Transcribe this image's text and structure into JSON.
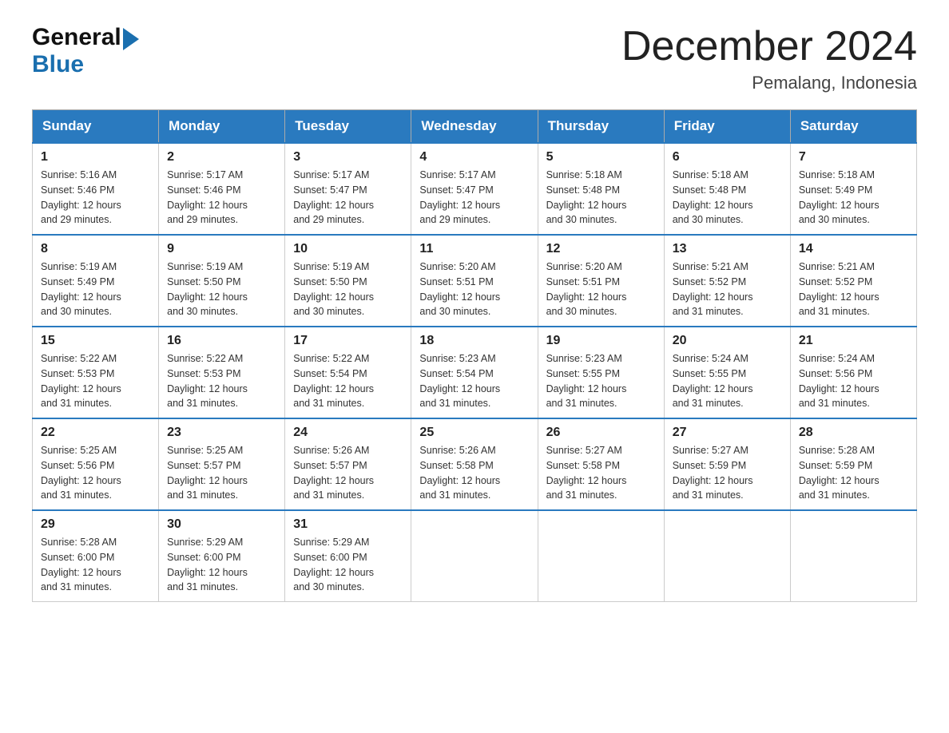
{
  "header": {
    "logo_general": "General",
    "logo_blue": "Blue",
    "month_title": "December 2024",
    "location": "Pemalang, Indonesia"
  },
  "weekdays": [
    "Sunday",
    "Monday",
    "Tuesday",
    "Wednesday",
    "Thursday",
    "Friday",
    "Saturday"
  ],
  "weeks": [
    [
      {
        "day": "1",
        "sunrise": "5:16 AM",
        "sunset": "5:46 PM",
        "daylight": "12 hours and 29 minutes."
      },
      {
        "day": "2",
        "sunrise": "5:17 AM",
        "sunset": "5:46 PM",
        "daylight": "12 hours and 29 minutes."
      },
      {
        "day": "3",
        "sunrise": "5:17 AM",
        "sunset": "5:47 PM",
        "daylight": "12 hours and 29 minutes."
      },
      {
        "day": "4",
        "sunrise": "5:17 AM",
        "sunset": "5:47 PM",
        "daylight": "12 hours and 29 minutes."
      },
      {
        "day": "5",
        "sunrise": "5:18 AM",
        "sunset": "5:48 PM",
        "daylight": "12 hours and 30 minutes."
      },
      {
        "day": "6",
        "sunrise": "5:18 AM",
        "sunset": "5:48 PM",
        "daylight": "12 hours and 30 minutes."
      },
      {
        "day": "7",
        "sunrise": "5:18 AM",
        "sunset": "5:49 PM",
        "daylight": "12 hours and 30 minutes."
      }
    ],
    [
      {
        "day": "8",
        "sunrise": "5:19 AM",
        "sunset": "5:49 PM",
        "daylight": "12 hours and 30 minutes."
      },
      {
        "day": "9",
        "sunrise": "5:19 AM",
        "sunset": "5:50 PM",
        "daylight": "12 hours and 30 minutes."
      },
      {
        "day": "10",
        "sunrise": "5:19 AM",
        "sunset": "5:50 PM",
        "daylight": "12 hours and 30 minutes."
      },
      {
        "day": "11",
        "sunrise": "5:20 AM",
        "sunset": "5:51 PM",
        "daylight": "12 hours and 30 minutes."
      },
      {
        "day": "12",
        "sunrise": "5:20 AM",
        "sunset": "5:51 PM",
        "daylight": "12 hours and 30 minutes."
      },
      {
        "day": "13",
        "sunrise": "5:21 AM",
        "sunset": "5:52 PM",
        "daylight": "12 hours and 31 minutes."
      },
      {
        "day": "14",
        "sunrise": "5:21 AM",
        "sunset": "5:52 PM",
        "daylight": "12 hours and 31 minutes."
      }
    ],
    [
      {
        "day": "15",
        "sunrise": "5:22 AM",
        "sunset": "5:53 PM",
        "daylight": "12 hours and 31 minutes."
      },
      {
        "day": "16",
        "sunrise": "5:22 AM",
        "sunset": "5:53 PM",
        "daylight": "12 hours and 31 minutes."
      },
      {
        "day": "17",
        "sunrise": "5:22 AM",
        "sunset": "5:54 PM",
        "daylight": "12 hours and 31 minutes."
      },
      {
        "day": "18",
        "sunrise": "5:23 AM",
        "sunset": "5:54 PM",
        "daylight": "12 hours and 31 minutes."
      },
      {
        "day": "19",
        "sunrise": "5:23 AM",
        "sunset": "5:55 PM",
        "daylight": "12 hours and 31 minutes."
      },
      {
        "day": "20",
        "sunrise": "5:24 AM",
        "sunset": "5:55 PM",
        "daylight": "12 hours and 31 minutes."
      },
      {
        "day": "21",
        "sunrise": "5:24 AM",
        "sunset": "5:56 PM",
        "daylight": "12 hours and 31 minutes."
      }
    ],
    [
      {
        "day": "22",
        "sunrise": "5:25 AM",
        "sunset": "5:56 PM",
        "daylight": "12 hours and 31 minutes."
      },
      {
        "day": "23",
        "sunrise": "5:25 AM",
        "sunset": "5:57 PM",
        "daylight": "12 hours and 31 minutes."
      },
      {
        "day": "24",
        "sunrise": "5:26 AM",
        "sunset": "5:57 PM",
        "daylight": "12 hours and 31 minutes."
      },
      {
        "day": "25",
        "sunrise": "5:26 AM",
        "sunset": "5:58 PM",
        "daylight": "12 hours and 31 minutes."
      },
      {
        "day": "26",
        "sunrise": "5:27 AM",
        "sunset": "5:58 PM",
        "daylight": "12 hours and 31 minutes."
      },
      {
        "day": "27",
        "sunrise": "5:27 AM",
        "sunset": "5:59 PM",
        "daylight": "12 hours and 31 minutes."
      },
      {
        "day": "28",
        "sunrise": "5:28 AM",
        "sunset": "5:59 PM",
        "daylight": "12 hours and 31 minutes."
      }
    ],
    [
      {
        "day": "29",
        "sunrise": "5:28 AM",
        "sunset": "6:00 PM",
        "daylight": "12 hours and 31 minutes."
      },
      {
        "day": "30",
        "sunrise": "5:29 AM",
        "sunset": "6:00 PM",
        "daylight": "12 hours and 31 minutes."
      },
      {
        "day": "31",
        "sunrise": "5:29 AM",
        "sunset": "6:00 PM",
        "daylight": "12 hours and 30 minutes."
      },
      null,
      null,
      null,
      null
    ]
  ],
  "labels": {
    "sunrise_prefix": "Sunrise: ",
    "sunset_prefix": "Sunset: ",
    "daylight_prefix": "Daylight: "
  }
}
